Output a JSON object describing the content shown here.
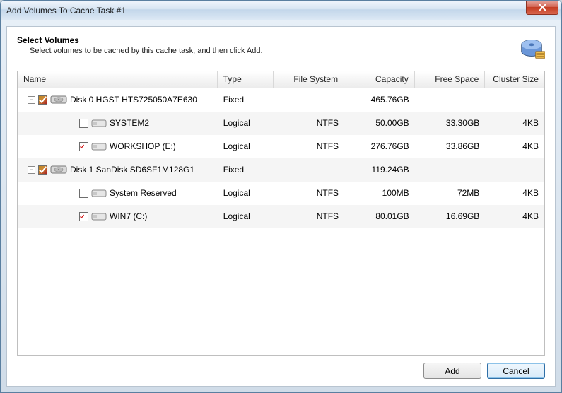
{
  "window": {
    "title": "Add Volumes To Cache Task #1"
  },
  "header": {
    "title": "Select Volumes",
    "subtitle": "Select volumes to be cached by this cache task, and then click Add."
  },
  "columns": {
    "name": "Name",
    "type": "Type",
    "fs": "File System",
    "capacity": "Capacity",
    "free": "Free Space",
    "cluster": "Cluster Size"
  },
  "rows": [
    {
      "indent": 0,
      "expander": "−",
      "check": "mixed",
      "icon": "disk",
      "name": "Disk 0 HGST HTS725050A7E630",
      "type": "Fixed",
      "fs": "",
      "capacity": "465.76GB",
      "free": "",
      "cluster": ""
    },
    {
      "indent": 1,
      "expander": "",
      "check": "unchecked",
      "icon": "vol",
      "name": "SYSTEM2",
      "type": "Logical",
      "fs": "NTFS",
      "capacity": "50.00GB",
      "free": "33.30GB",
      "cluster": "4KB"
    },
    {
      "indent": 1,
      "expander": "",
      "check": "checked",
      "icon": "vol",
      "name": "WORKSHOP (E:)",
      "type": "Logical",
      "fs": "NTFS",
      "capacity": "276.76GB",
      "free": "33.86GB",
      "cluster": "4KB"
    },
    {
      "indent": 0,
      "expander": "−",
      "check": "mixed",
      "icon": "disk",
      "name": "Disk 1 SanDisk SD6SF1M128G1",
      "type": "Fixed",
      "fs": "",
      "capacity": "119.24GB",
      "free": "",
      "cluster": ""
    },
    {
      "indent": 1,
      "expander": "",
      "check": "unchecked",
      "icon": "vol",
      "name": "System Reserved",
      "type": "Logical",
      "fs": "NTFS",
      "capacity": "100MB",
      "free": "72MB",
      "cluster": "4KB"
    },
    {
      "indent": 1,
      "expander": "",
      "check": "checked",
      "icon": "vol",
      "name": "WIN7 (C:)",
      "type": "Logical",
      "fs": "NTFS",
      "capacity": "80.01GB",
      "free": "16.69GB",
      "cluster": "4KB"
    }
  ],
  "buttons": {
    "add": "Add",
    "cancel": "Cancel"
  }
}
